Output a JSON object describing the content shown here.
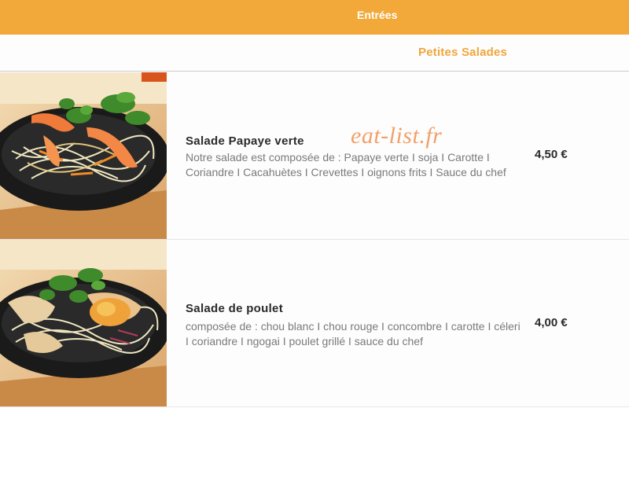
{
  "header": {
    "title": "Entrées"
  },
  "section": {
    "title": "Petites Salades"
  },
  "watermark": "eat-list.fr",
  "items": [
    {
      "name": "Salade Papaye verte",
      "description": "Notre salade est composée de : Papaye verte I soja I Carotte I Coriandre I Cacahuètes I Crevettes I oignons frits I Sauce du chef",
      "price": "4,50 €",
      "image": "salad-papaya-shrimp"
    },
    {
      "name": "Salade de poulet",
      "description": "composée de : chou blanc I chou rouge I concombre I carotte I céleri I coriandre I ngogai I poulet grillé I sauce du chef",
      "price": "4,00 €",
      "image": "salad-chicken"
    }
  ],
  "colors": {
    "accent": "#f2a93a",
    "section_title": "#f0a63c",
    "watermark": "#f2a06a"
  }
}
